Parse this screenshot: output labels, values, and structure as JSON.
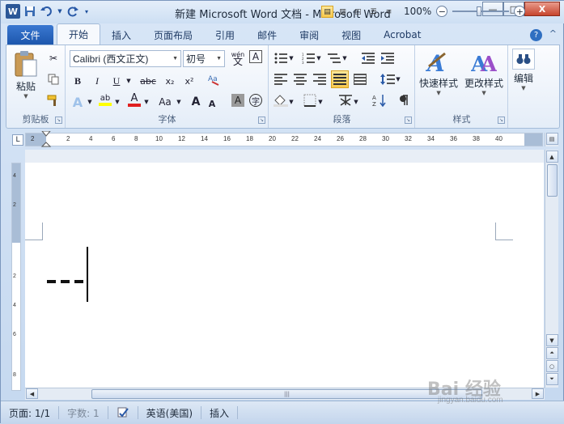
{
  "window": {
    "title": "新建 Microsoft Word 文档 - Microsoft Word",
    "app_icon": "W",
    "controls": {
      "minimize": "—",
      "maximize": "□",
      "close": "X"
    }
  },
  "quick_access": [
    {
      "name": "save-icon",
      "glyph": "▪"
    },
    {
      "name": "undo-icon",
      "glyph": "↶"
    },
    {
      "name": "redo-icon",
      "glyph": "↺"
    }
  ],
  "tabs": {
    "file": "文件",
    "items": [
      "开始",
      "插入",
      "页面布局",
      "引用",
      "邮件",
      "审阅",
      "视图",
      "Acrobat"
    ],
    "active": "开始",
    "help": "?"
  },
  "ribbon": {
    "clipboard": {
      "label": "剪贴板",
      "paste": "粘贴"
    },
    "font": {
      "label": "字体",
      "font_name": "Calibri (西文正文)",
      "font_size": "初号",
      "wen_label": "wén",
      "bold": "B",
      "italic": "I",
      "underline": "U",
      "strike": "abc",
      "subscript": "x₂",
      "superscript": "x²",
      "grow": "A",
      "shrink": "A",
      "case": "Aa",
      "shade": "A",
      "enclose": "字",
      "text_effect": "A",
      "highlight": "ab",
      "color": "A"
    },
    "paragraph": {
      "label": "段落"
    },
    "styles": {
      "label": "样式",
      "quick": "快速样式",
      "change": "更改样式"
    },
    "editing": {
      "label": "编辑"
    }
  },
  "ruler": {
    "h_ticks": [
      "2",
      "2",
      "4",
      "6",
      "8",
      "10",
      "12",
      "14",
      "16",
      "18",
      "20",
      "22",
      "24",
      "26",
      "28",
      "30",
      "32",
      "34",
      "36",
      "38",
      "40"
    ],
    "v_ticks": [
      "4",
      "2",
      "2",
      "4",
      "6",
      "8"
    ]
  },
  "document": {
    "content_marks": "---"
  },
  "statusbar": {
    "page": "页面: 1/1",
    "words": "字数: 1",
    "language": "英语(美国)",
    "mode": "插入",
    "zoom": "100%",
    "zoom_out": "−",
    "zoom_in": "+"
  },
  "watermark": {
    "text": "Bai 经验",
    "sub": "jingyan.baidu.com"
  }
}
